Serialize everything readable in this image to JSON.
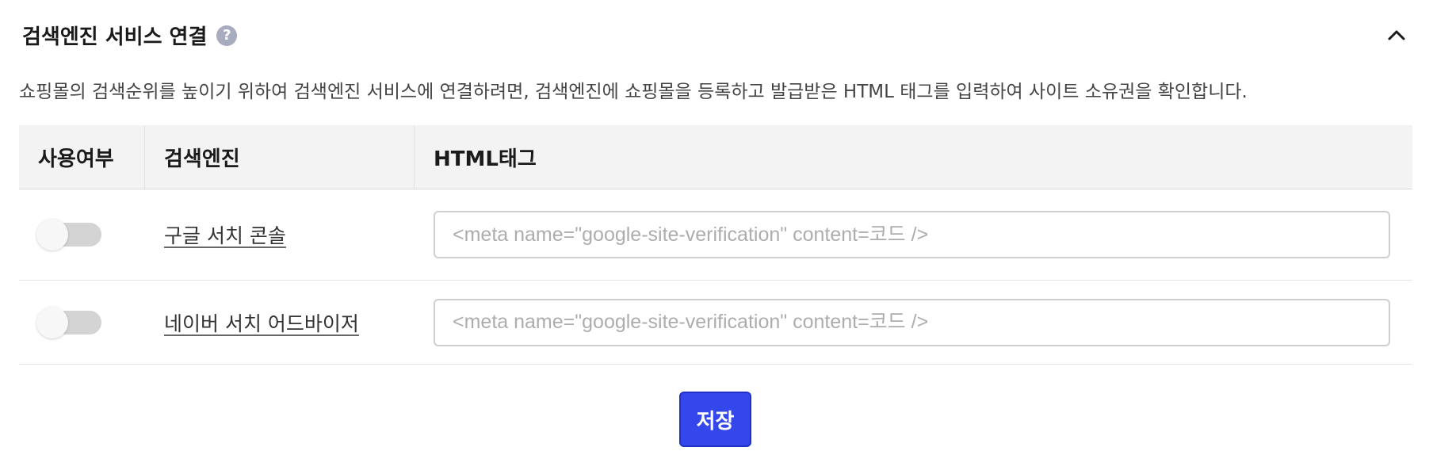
{
  "section": {
    "title": "검색엔진 서비스 연결",
    "help_icon": "?",
    "collapse_icon": "chevron-up-icon",
    "description": "쇼핑몰의 검색순위를 높이기 위하여 검색엔진 서비스에 연결하려면, 검색엔진에 쇼핑몰을 등록하고 발급받은 HTML 태그를 입력하여 사이트 소유권을 확인합니다."
  },
  "table": {
    "headers": {
      "use": "사용여부",
      "engine": "검색엔진",
      "html": "HTML태그"
    },
    "rows": [
      {
        "enabled": false,
        "engine": "구글 서치 콘솔",
        "html_value": "",
        "html_placeholder": "<meta name=\"google-site-verification\" content=코드 />"
      },
      {
        "enabled": false,
        "engine": "네이버 서치 어드바이저",
        "html_value": "",
        "html_placeholder": "<meta name=\"google-site-verification\" content=코드 />"
      }
    ]
  },
  "actions": {
    "save_label": "저장"
  },
  "colors": {
    "primary": "#3447ea",
    "header_bg": "#f3f3f3",
    "toggle_off": "#d4d4d4"
  }
}
